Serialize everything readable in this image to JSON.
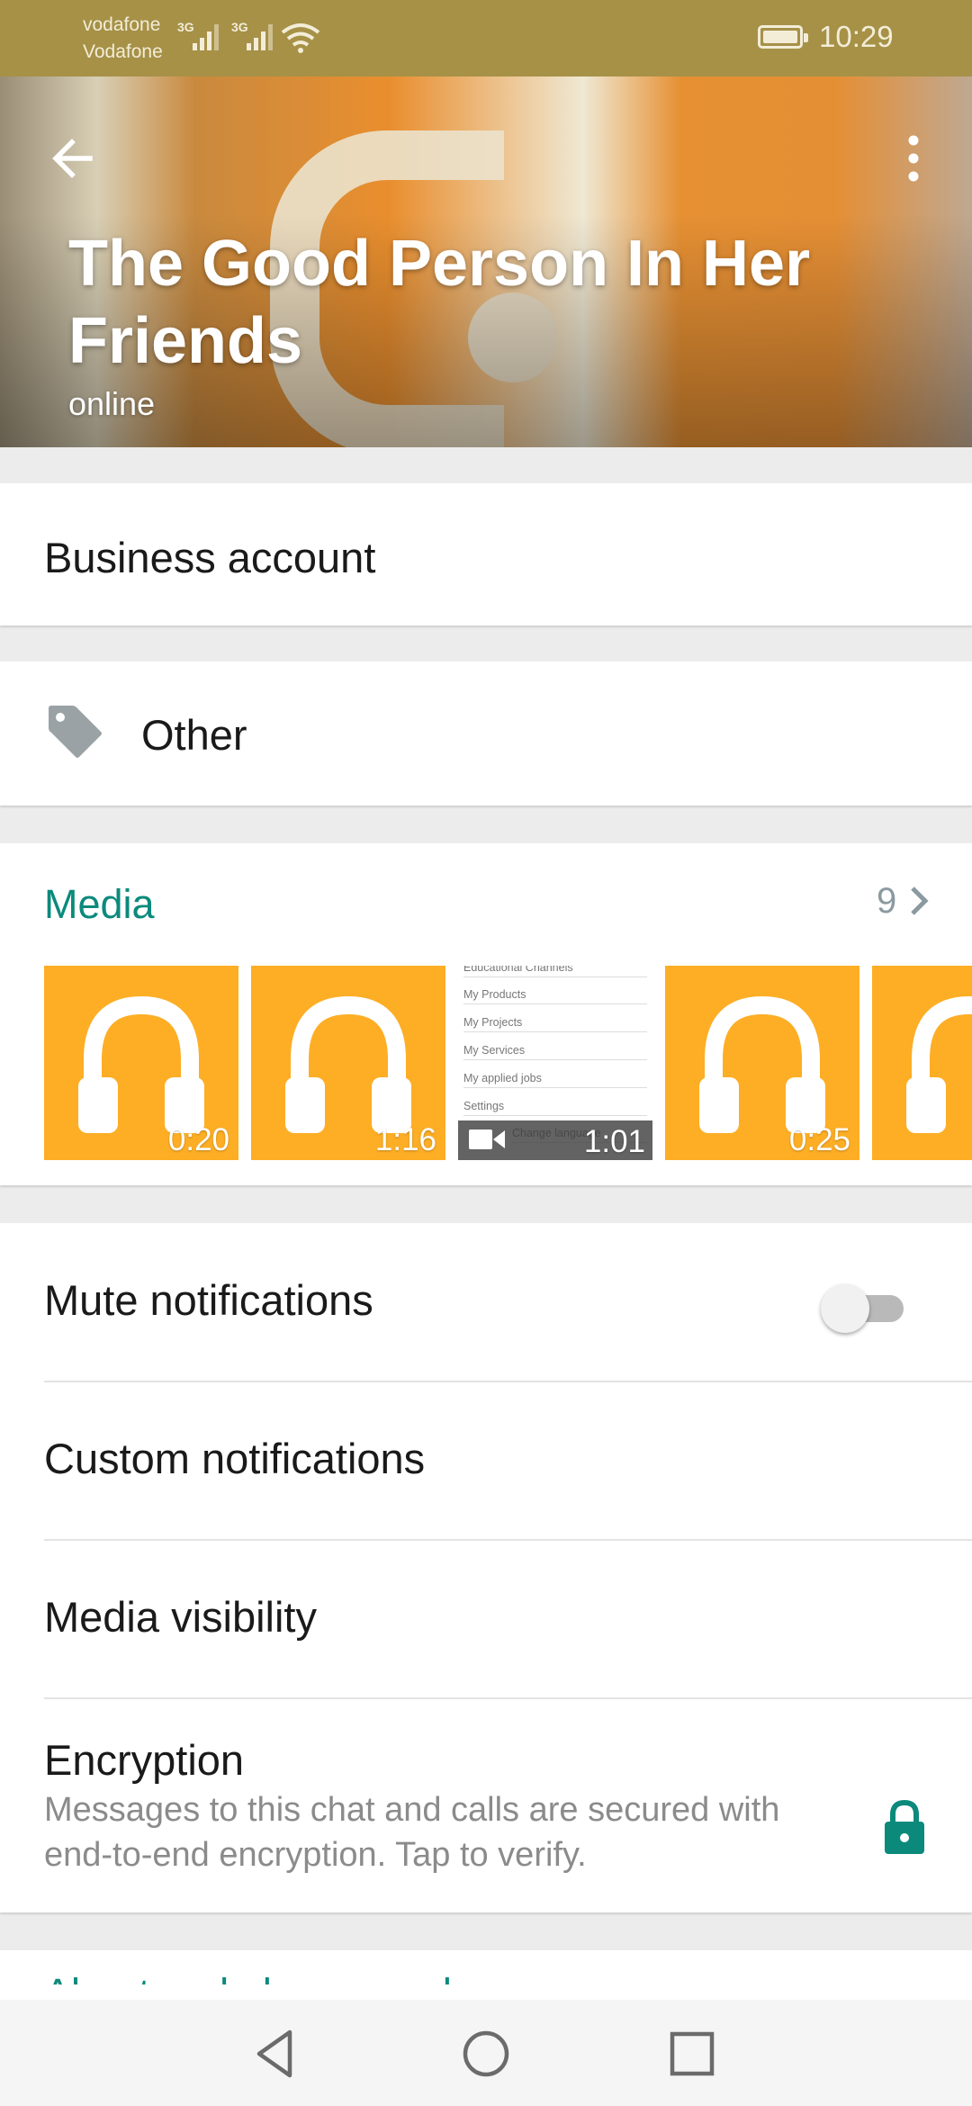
{
  "status_bar": {
    "carrier_1": "vodafone",
    "carrier_2": "Vodafone",
    "net_1": "3G",
    "net_2": "3G",
    "time": "10:29"
  },
  "header": {
    "title": "The Good Person In Her Friends",
    "status": "online"
  },
  "business": {
    "label": "Business account"
  },
  "category": {
    "label": "Other",
    "icon": "tag-icon"
  },
  "media": {
    "title": "Media",
    "count": "9",
    "items": [
      {
        "type": "audio",
        "duration": "0:20"
      },
      {
        "type": "audio",
        "duration": "1:16"
      },
      {
        "type": "video",
        "duration": "1:01",
        "doc_lines": [
          "Educational Channels",
          "My Products",
          "My Projects",
          "My Services",
          "My applied jobs",
          "Settings",
          "Change language"
        ]
      },
      {
        "type": "audio",
        "duration": "0:25"
      },
      {
        "type": "audio",
        "duration": ""
      }
    ]
  },
  "settings": {
    "mute": {
      "label": "Mute notifications",
      "enabled": false
    },
    "custom": {
      "label": "Custom notifications"
    },
    "visibility": {
      "label": "Media visibility"
    },
    "encryption": {
      "label": "Encryption",
      "description": "Messages to this chat and calls are secured with end-to-end encryption. Tap to verify."
    }
  },
  "next_section": {
    "title": "About and phone number"
  },
  "colors": {
    "status_bar": "#a69147",
    "accent": "#0b8a7c",
    "audio_tile": "#fdae25"
  }
}
